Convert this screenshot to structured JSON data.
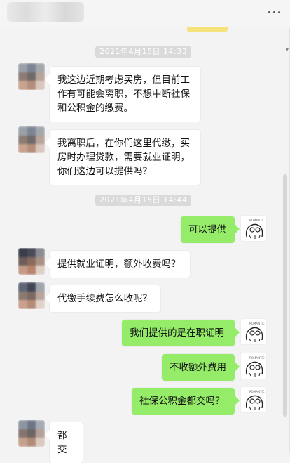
{
  "timestamps": [
    "2021年4月15日  14:33",
    "2021年4月15日  14:44"
  ],
  "messages": [
    {
      "side": "in",
      "lines": [
        "我这边近期考虑买房，但目前工",
        "作有可能会离职，不想中断社保",
        "和公积金的缴费。"
      ]
    },
    {
      "side": "in",
      "lines": [
        "我离职后，在你们这里代缴，买",
        "房时办理贷款，需要就业证明，",
        "你们这边可以提供吗？"
      ]
    },
    {
      "side": "out",
      "lines": [
        "可以提供"
      ]
    },
    {
      "side": "in",
      "lines": [
        "提供就业证明，额外收费吗？"
      ]
    },
    {
      "side": "in",
      "lines": [
        "代缴手续费怎么收呢？"
      ]
    },
    {
      "side": "out",
      "lines": [
        "我们提供的是在职证明"
      ]
    },
    {
      "side": "out",
      "lines": [
        "不收额外费用"
      ]
    },
    {
      "side": "out",
      "lines": [
        "社保公积金都交吗？"
      ]
    },
    {
      "side": "in",
      "lines": [
        "都交"
      ]
    }
  ],
  "icons": {
    "menu": "more-dots-icon",
    "customer_avatar": "avatar-blurred",
    "agent_avatar": "sketch-character-avatar"
  },
  "colors": {
    "background": "#f3f3f3",
    "incoming_bubble": "#ffffff",
    "outgoing_bubble": "#95ec69",
    "timestamp_bg": "#dadada"
  }
}
